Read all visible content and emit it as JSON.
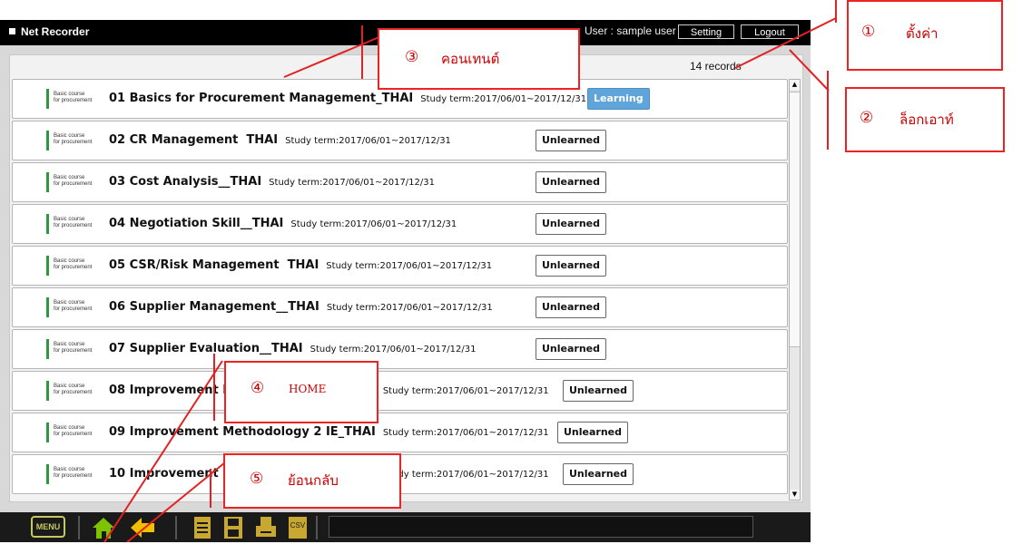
{
  "header": {
    "app_title": "Net Recorder",
    "user_text": "User : sample user",
    "setting_label": "Setting",
    "logout_label": "Logout"
  },
  "records_count": "14 records",
  "course_tag_line1": "Basic course",
  "course_tag_line2": "for procurement",
  "courses": [
    {
      "title": "01 Basics for Procurement Management_THAI",
      "term": "Study term:2017/06/01~2017/12/31",
      "status": "Learning"
    },
    {
      "title": "02 CR Management  THAI",
      "term": "Study term:2017/06/01~2017/12/31",
      "status": "Unlearned"
    },
    {
      "title": "03 Cost Analysis__THAI",
      "term": "Study term:2017/06/01~2017/12/31",
      "status": "Unlearned"
    },
    {
      "title": "04 Negotiation Skill__THAI",
      "term": "Study term:2017/06/01~2017/12/31",
      "status": "Unlearned"
    },
    {
      "title": "05 CSR/Risk Management  THAI",
      "term": "Study term:2017/06/01~2017/12/31",
      "status": "Unlearned"
    },
    {
      "title": "06 Supplier Management__THAI",
      "term": "Study term:2017/06/01~2017/12/31",
      "status": "Unlearned"
    },
    {
      "title": "07 Supplier Evaluation__THAI",
      "term": "Study term:2017/06/01~2017/12/31",
      "status": "Unlearned"
    },
    {
      "title": "08 Improvement Methodology 1 IE_THAI",
      "term": "Study term:2017/06/01~2017/12/31",
      "status": "Unlearned"
    },
    {
      "title": "09 Improvement Methodology 2 IE_THAI",
      "term": "Study term:2017/06/01~2017/12/31",
      "status": "Unlearned"
    },
    {
      "title": "10 Improvement Methodology 3 IE_THAI",
      "term": "Study term:2017/06/01~2017/12/31",
      "status": "Unlearned"
    }
  ],
  "bottom": {
    "menu_label": "MENU",
    "csv_label": "CSV",
    "icons": [
      "home-icon",
      "back-arrow-icon",
      "document-icon",
      "save-icon",
      "print-icon",
      "csv-icon"
    ]
  },
  "annotations": [
    {
      "num": "①",
      "label": "ตั้งค่า"
    },
    {
      "num": "②",
      "label": "ล็อกเอาท์"
    },
    {
      "num": "③",
      "label": "คอนเทนต์"
    },
    {
      "num": "④",
      "label": "HOME"
    },
    {
      "num": "⑤",
      "label": "ย้อนกลับ"
    }
  ],
  "colors": {
    "annotation": "#e22222",
    "learning": "#5fa5d9",
    "course_bar": "#2a9a3a",
    "menu": "#c8c860",
    "home_icon": "#7ec300",
    "back_icon": "#f0c000"
  }
}
